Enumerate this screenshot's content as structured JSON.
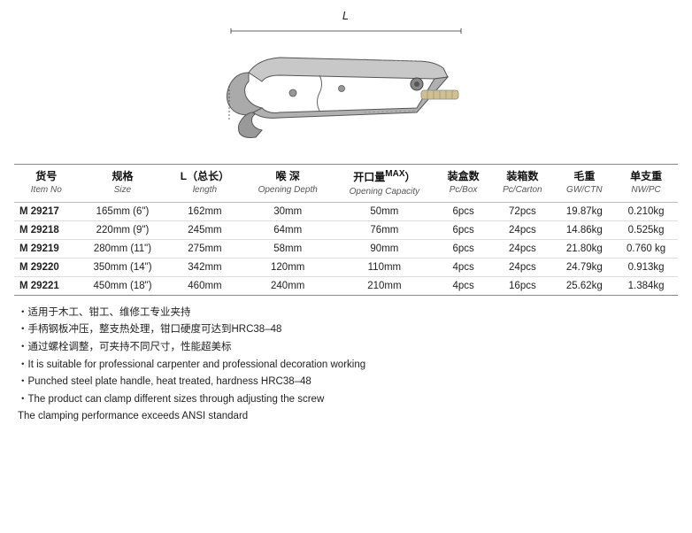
{
  "diagram": {
    "l_label": "L"
  },
  "table": {
    "headers": [
      {
        "main": "货号",
        "sub": "Item No"
      },
      {
        "main": "规格",
        "sub": "Size"
      },
      {
        "main": "L（总长）",
        "sub": "length"
      },
      {
        "main": "喉 深",
        "sub": "Opening Depth"
      },
      {
        "main": "开口量MAX）",
        "sub": "Opening Capacity"
      },
      {
        "main": "装盒数",
        "sub": "Pc/Box"
      },
      {
        "main": "装箱数",
        "sub": "Pc/Carton"
      },
      {
        "main": "毛重",
        "sub": "GW/CTN"
      },
      {
        "main": "单支重",
        "sub": "NW/PC"
      }
    ],
    "rows": [
      {
        "item": "M 29217",
        "size": "165mm (6\")",
        "length": "162mm",
        "depth": "30mm",
        "capacity": "50mm",
        "pcbox": "6pcs",
        "pccarton": "72pcs",
        "gw": "19.87kg",
        "nw": "0.210kg"
      },
      {
        "item": "M 29218",
        "size": "220mm (9\")",
        "length": "245mm",
        "depth": "64mm",
        "capacity": "76mm",
        "pcbox": "6pcs",
        "pccarton": "24pcs",
        "gw": "14.86kg",
        "nw": "0.525kg"
      },
      {
        "item": "M 29219",
        "size": "280mm (11\")",
        "length": "275mm",
        "depth": "58mm",
        "capacity": "90mm",
        "pcbox": "6pcs",
        "pccarton": "24pcs",
        "gw": "21.80kg",
        "nw": "0.760 kg"
      },
      {
        "item": "M 29220",
        "size": "350mm (14\")",
        "length": "342mm",
        "depth": "120mm",
        "capacity": "110mm",
        "pcbox": "4pcs",
        "pccarton": "24pcs",
        "gw": "24.79kg",
        "nw": "0.913kg"
      },
      {
        "item": "M 29221",
        "size": "450mm (18\")",
        "length": "460mm",
        "depth": "240mm",
        "capacity": "210mm",
        "pcbox": "4pcs",
        "pccarton": "16pcs",
        "gw": "25.62kg",
        "nw": "1.384kg"
      }
    ]
  },
  "features": {
    "lines": [
      {
        "text": "适用于木工、钳工、维修工专业夹持",
        "dot": true
      },
      {
        "text": "手柄钢板冲压，整支热处理，钳口硬度可达到HRC38–48",
        "dot": true
      },
      {
        "text": "通过螺栓调整，可夹持不同尺寸，性能超美标",
        "dot": true
      },
      {
        "text": "It is suitable for professional carpenter and professional decoration working",
        "dot": true
      },
      {
        "text": "Punched steel plate handle, heat treated, hardness HRC38–48",
        "dot": true
      },
      {
        "text": "The product can clamp different sizes through adjusting the screw",
        "dot": true
      },
      {
        "text": "The clamping performance exceeds ANSI standard",
        "dot": false
      }
    ]
  }
}
